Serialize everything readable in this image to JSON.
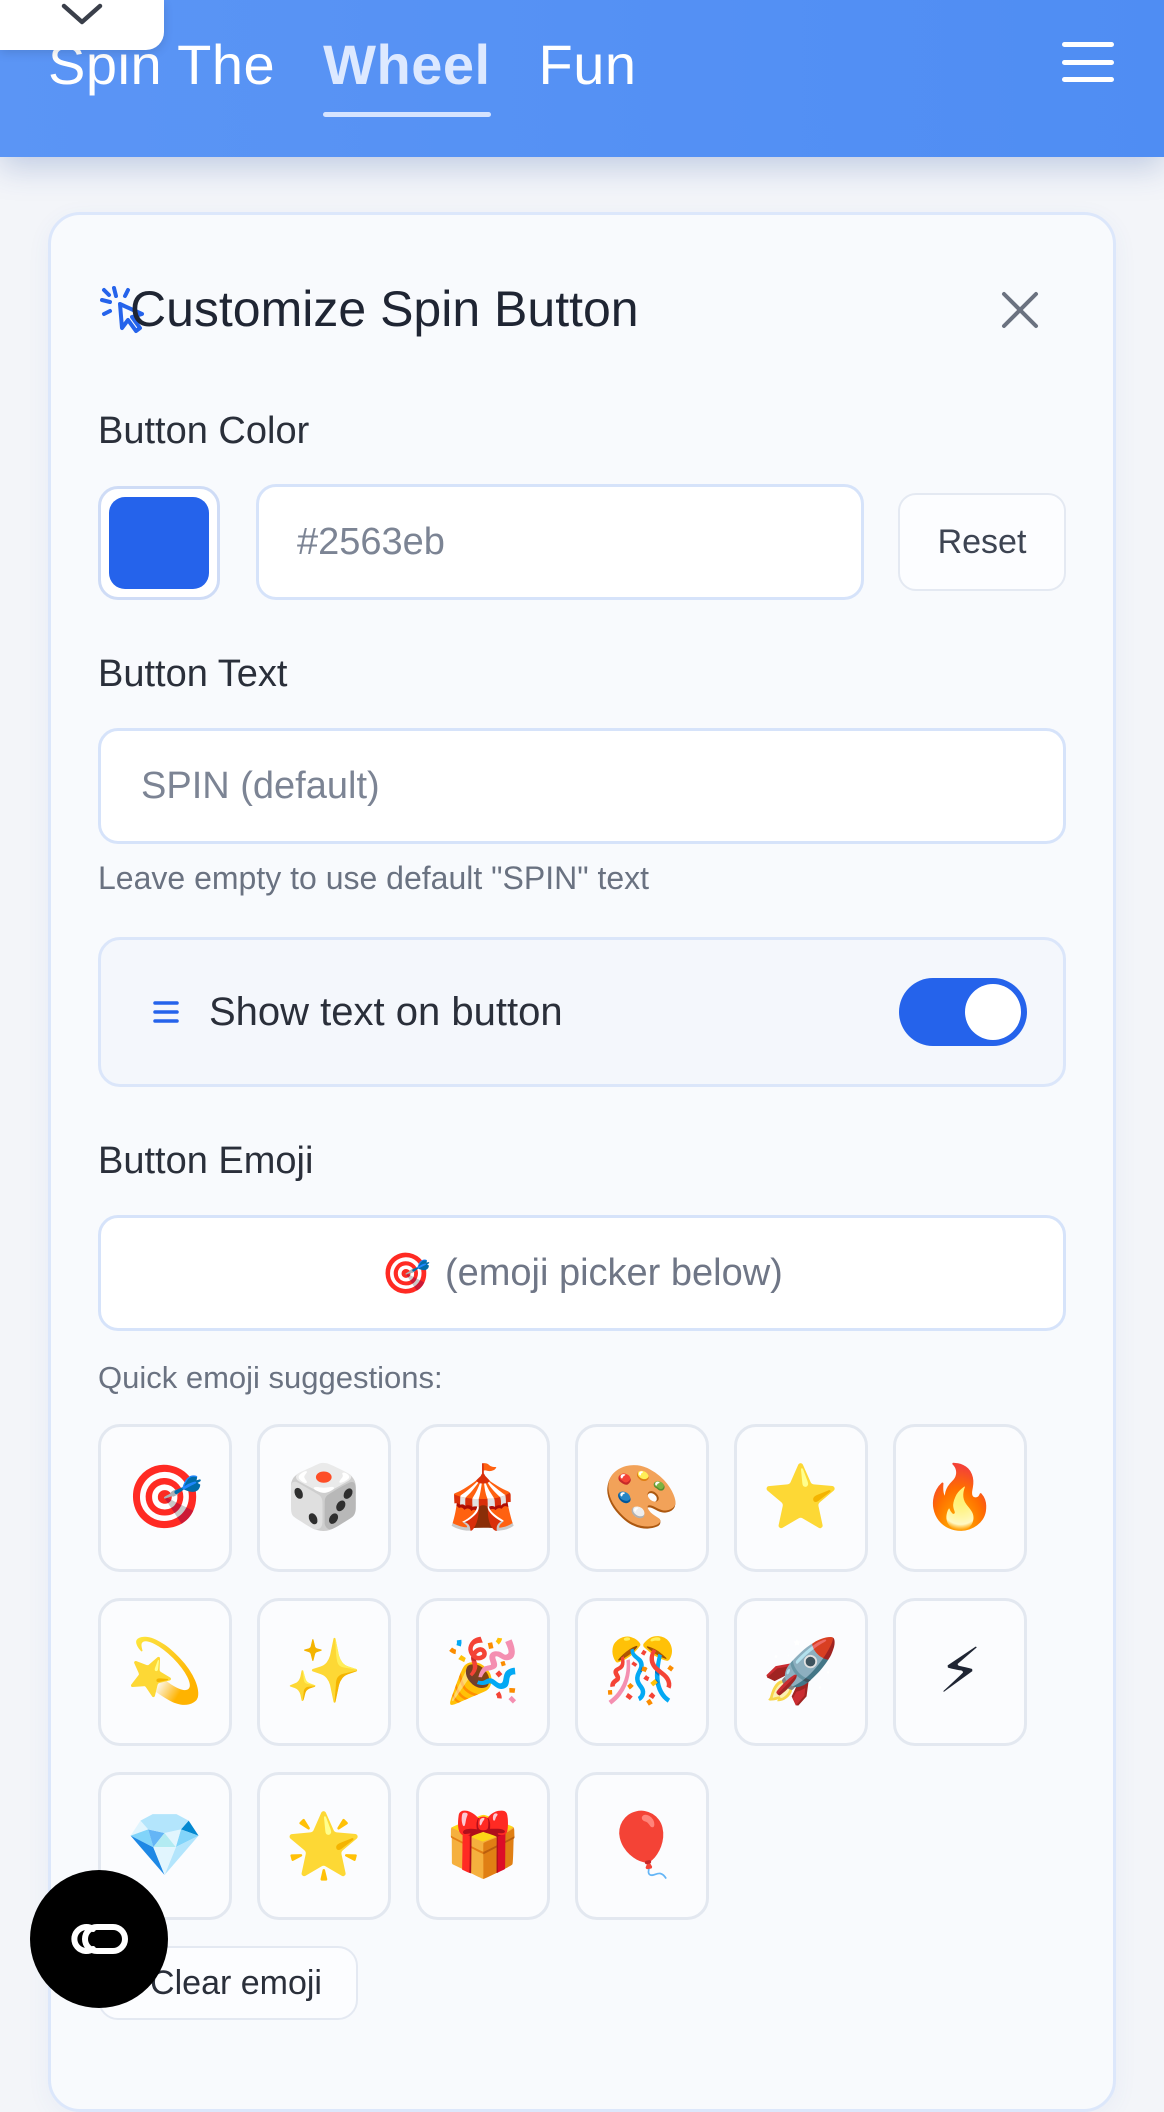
{
  "header": {
    "brand_part1": "Spin The",
    "brand_part2": "Wheel",
    "brand_part3": "Fun"
  },
  "panel": {
    "title": "Customize Spin Button",
    "button_color": {
      "label": "Button Color",
      "swatch_color": "#2563eb",
      "placeholder": "#2563eb",
      "reset_label": "Reset"
    },
    "button_text": {
      "label": "Button Text",
      "placeholder": "SPIN (default)",
      "hint": "Leave empty to use default \"SPIN\" text"
    },
    "show_text": {
      "label": "Show text on button",
      "enabled": true,
      "accent": "#2563eb"
    },
    "button_emoji": {
      "label": "Button Emoji",
      "current": "🎯",
      "placeholder": "(emoji picker below)",
      "suggestions_label": "Quick emoji suggestions:",
      "suggestions": [
        "🎯",
        "🎲",
        "🎪",
        "🎨",
        "⭐",
        "🔥",
        "💫",
        "✨",
        "🎉",
        "🎊",
        "🚀",
        "⚡",
        "💎",
        "🌟",
        "🎁",
        "🎈"
      ],
      "clear_label": "Clear emoji"
    }
  },
  "icons": {
    "cursor_click": "cursor-click-icon",
    "close": "close-icon",
    "menu": "menu-icon",
    "chevron": "chevron-down-icon",
    "lines": "text-lines-icon",
    "fab": "co-icon"
  }
}
